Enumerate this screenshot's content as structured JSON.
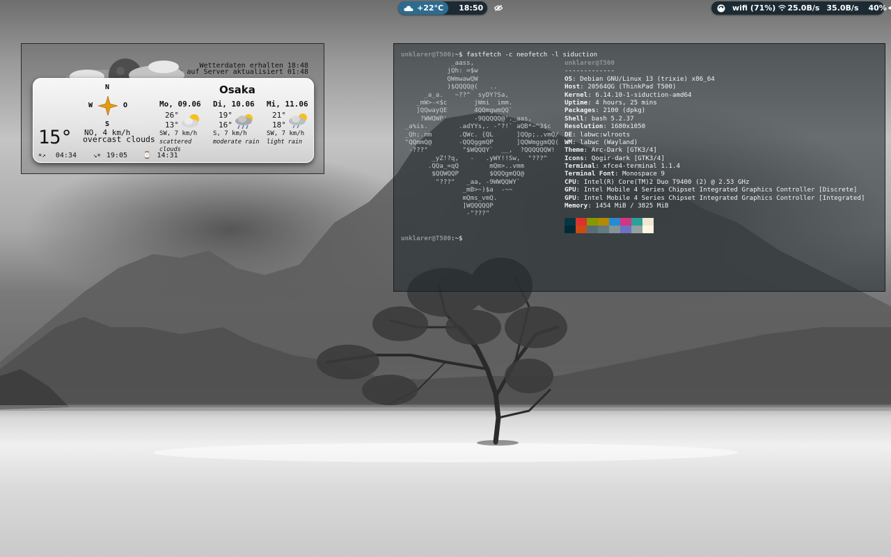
{
  "topbar": {
    "weather_temp": "+22°C",
    "clock": "18:50",
    "wifi": "wifi (71%)",
    "net_down": "25.0B/s",
    "net_up": "35.0B/s",
    "volume": "40%",
    "icons": [
      "weather-cloud-icon",
      "eye-icon",
      "update-icon",
      "wifi-icon",
      "speaker-icon",
      "power-icon"
    ]
  },
  "weather": {
    "status_line1": "Wetterdaten erhalten 18:48",
    "status_line2": "Wetterdaten auf Server aktualisiert 01:48",
    "city": "Osaka",
    "compass": {
      "n": "N",
      "w": "W",
      "o": "O",
      "s": "S"
    },
    "current_temp": "15°",
    "current_wind": "NO, 4 km/h",
    "current_desc": "overcast clouds",
    "sunrise": "04:34",
    "sunset": "19:05",
    "daylength": "14:31",
    "forecast": [
      {
        "day": "Mo, 09.06",
        "hi": "26°",
        "lo": "13°",
        "wind": "SW, 7 km/h",
        "desc": "scattered clouds",
        "icon": "sun-cloud-icon"
      },
      {
        "day": "Di, 10.06",
        "hi": "19°",
        "lo": "16°",
        "wind": "S, 7 km/h",
        "desc": "moderate rain",
        "icon": "rain-cloud-icon"
      },
      {
        "day": "Mi, 11.06",
        "hi": "21°",
        "lo": "18°",
        "wind": "SW, 7 km/h",
        "desc": "light rain",
        "icon": "sun-rain-icon"
      }
    ]
  },
  "terminal": {
    "prompt_user": "unklarer@T500",
    "prompt_suffix": ":~$ ",
    "command": "fastfetch -c neofetch -l siduction",
    "logo": [
      "             _aass,",
      "            jQh: =$w",
      "            QWmwawQW",
      "            )$QQQQ@(   ..",
      "      _a_a.   ~??^  syDY?Sa,",
      "    _mW>-<$c       jWmi  imm.",
      "    ]QQwayQE       4QQmgwmQQ`",
      "     ?WWQWP'       -9QQQQQ@'._aas,",
      " _a%is.        .adYYs,. -\"?!` aQB*~^3$c",
      " _Qh;.nm       .QWc. {QL      ]QQp;..vmQ/",
      " \"QQmmQ@       -QQQggmQP      ]QQWmggmQQ(",
      "  -???\"         \"$WQQQY`  __,  ?QQQQQQW!",
      "        _yZ!?q,   -   .yWY!!Sw,  \"???^",
      "       .QQa_=qQ        mQm>..vmm",
      "        $QQWQQP        $QQQgmQQ@",
      "         \"???\"   _aa, -9WWQQWY`",
      "                _mB>~)$a  -~~",
      "                mQms_vmQ.",
      "                ]WQQQQQP",
      "                 -\"???\""
    ],
    "info_title": "unklarer@T500",
    "info_sep": "-------------",
    "info": [
      {
        "k": "OS",
        "v": "Debian GNU/Linux 13 (trixie) x86_64"
      },
      {
        "k": "Host",
        "v": "20564QG (ThinkPad T500)"
      },
      {
        "k": "Kernel",
        "v": "6.14.10-1-siduction-amd64"
      },
      {
        "k": "Uptime",
        "v": "4 hours, 25 mins"
      },
      {
        "k": "Packages",
        "v": "2100 (dpkg)"
      },
      {
        "k": "Shell",
        "v": "bash 5.2.37"
      },
      {
        "k": "Resolution",
        "v": "1680x1050"
      },
      {
        "k": "DE",
        "v": "labwc:wlroots"
      },
      {
        "k": "WM",
        "v": "labwc (Wayland)"
      },
      {
        "k": "Theme",
        "v": "Arc-Dark [GTK3/4]"
      },
      {
        "k": "Icons",
        "v": "Qogir-dark [GTK3/4]"
      },
      {
        "k": "Terminal",
        "v": "xfce4-terminal 1.1.4"
      },
      {
        "k": "Terminal Font",
        "v": "Monospace 9"
      },
      {
        "k": "CPU",
        "v": "Intel(R) Core(TM)2 Duo T9400 (2) @ 2.53 GHz"
      },
      {
        "k": "GPU",
        "v": "Intel Mobile 4 Series Chipset Integrated Graphics Controller [Discrete]"
      },
      {
        "k": "GPU",
        "v": "Intel Mobile 4 Series Chipset Integrated Graphics Controller [Integrated]"
      },
      {
        "k": "Memory",
        "v": "1454 MiB / 3825 MiB"
      }
    ],
    "palette_top": [
      "#073642",
      "#dc322f",
      "#859900",
      "#b58900",
      "#268bd2",
      "#d33682",
      "#2aa198",
      "#eee8d5"
    ],
    "palette_bottom": [
      "#002b36",
      "#cb4b16",
      "#586e75",
      "#657b83",
      "#839496",
      "#6c71c4",
      "#93a1a1",
      "#fdf6e3"
    ]
  }
}
